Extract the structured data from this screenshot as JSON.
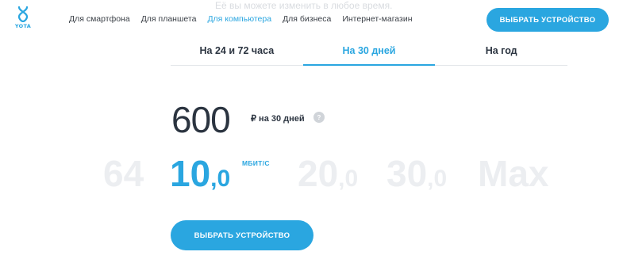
{
  "brand": {
    "logo_text": "YOTA",
    "accent_color": "#2aa6e0"
  },
  "header": {
    "ghost_text": "Её вы можете изменить в любое время.",
    "nav": [
      {
        "label": "Для смартфона",
        "active": false
      },
      {
        "label": "Для планшета",
        "active": false
      },
      {
        "label": "Для компьютера",
        "active": true
      },
      {
        "label": "Для бизнеса",
        "active": false
      },
      {
        "label": "Интернет-магазин",
        "active": false
      }
    ],
    "cta_label": "ВЫБРАТЬ УСТРОЙСТВО"
  },
  "tabs": [
    {
      "label": "На 24 и 72 часа",
      "active": false
    },
    {
      "label": "На 30 дней",
      "active": true
    },
    {
      "label": "На год",
      "active": false
    }
  ],
  "tariff": {
    "price": "600",
    "period": "₽ на 30 дней",
    "help_icon": "?"
  },
  "speeds": {
    "unit": "МБИТ/С",
    "options": [
      {
        "int": "64",
        "dec": "",
        "active": false
      },
      {
        "int": "10",
        "dec": ",0",
        "active": true
      },
      {
        "int": "20",
        "dec": ",0",
        "active": false
      },
      {
        "int": "30",
        "dec": ",0",
        "active": false
      },
      {
        "int": "Max",
        "dec": "",
        "active": false
      }
    ]
  },
  "main_cta_label": "ВЫБРАТЬ УСТРОЙСТВО"
}
